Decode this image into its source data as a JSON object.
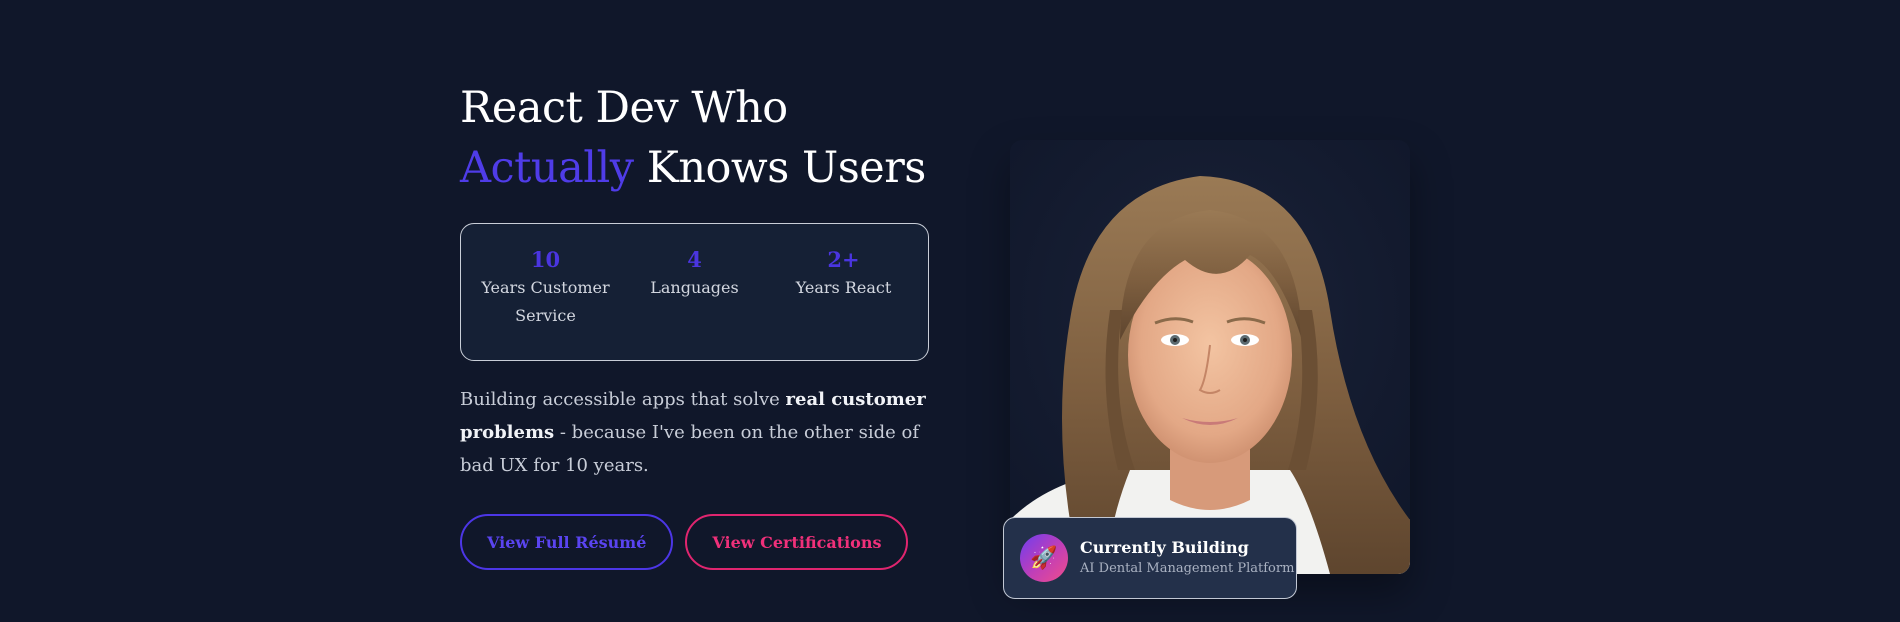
{
  "hero": {
    "headline": {
      "line1": "React Dev Who",
      "accent": "Actually",
      "rest": " Knows Users"
    },
    "stats": [
      {
        "value": "10",
        "label_line1": "Years Customer",
        "label_line2": "Service"
      },
      {
        "value": "4",
        "label_line1": "Languages",
        "label_line2": ""
      },
      {
        "value": "2+",
        "label_line1": "Years React",
        "label_line2": ""
      }
    ],
    "intro": {
      "part1": "Building accessible apps that solve ",
      "bold": "real customer problems",
      "part2": " - because I've been on the other side of bad UX for 10 years."
    },
    "buttons": {
      "resume": "View Full Résumé",
      "certifications": "View Certifications"
    },
    "building": {
      "icon": "rocket-icon",
      "title": "Currently Building",
      "subtitle": "AI Dental Management Platform"
    },
    "portrait_alt": "portrait-photo"
  },
  "colors": {
    "background": "#10172a",
    "accent": "#4f3ce8",
    "pink": "#e0256f",
    "card": "#152035"
  }
}
